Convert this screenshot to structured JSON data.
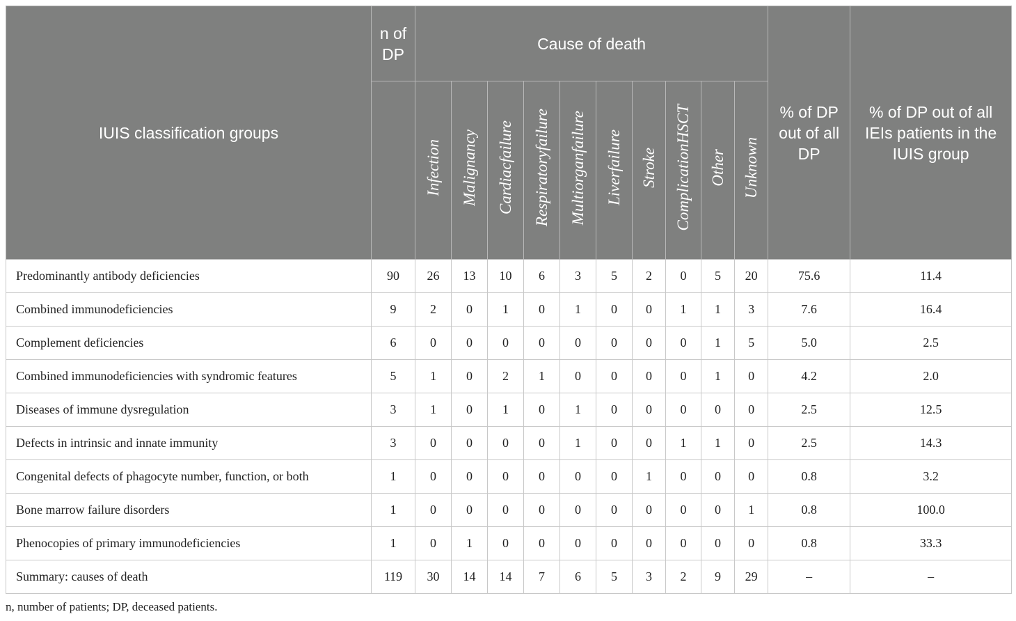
{
  "header": {
    "group_col": "IUIS classification groups",
    "n_col": "n of DP",
    "cause_group": "Cause of death",
    "causes": [
      "Infection",
      "Malignancy",
      "Cardiacfailure",
      "Respiratoryfailure",
      "Multiorganfailure",
      "Liverfailure",
      "Stroke",
      "ComplicationHSCT",
      "Other",
      "Unknown"
    ],
    "pct_all_col": "% of DP out of all DP",
    "pct_group_col": "% of DP out of all IEIs patients in the IUIS group"
  },
  "rows": [
    {
      "group": "Predominantly antibody deficiencies",
      "n": "90",
      "causes": [
        "26",
        "13",
        "10",
        "6",
        "3",
        "5",
        "2",
        "0",
        "5",
        "20"
      ],
      "pct_all": "75.6",
      "pct_group": "11.4"
    },
    {
      "group": "Combined immunodeficiencies",
      "n": "9",
      "causes": [
        "2",
        "0",
        "1",
        "0",
        "1",
        "0",
        "0",
        "1",
        "1",
        "3"
      ],
      "pct_all": "7.6",
      "pct_group": "16.4"
    },
    {
      "group": "Complement deficiencies",
      "n": "6",
      "causes": [
        "0",
        "0",
        "0",
        "0",
        "0",
        "0",
        "0",
        "0",
        "1",
        "5"
      ],
      "pct_all": "5.0",
      "pct_group": "2.5"
    },
    {
      "group": "Combined immunodeficiencies with syndromic features",
      "n": "5",
      "causes": [
        "1",
        "0",
        "2",
        "1",
        "0",
        "0",
        "0",
        "0",
        "1",
        "0"
      ],
      "pct_all": "4.2",
      "pct_group": "2.0"
    },
    {
      "group": "Diseases of immune dysregulation",
      "n": "3",
      "causes": [
        "1",
        "0",
        "1",
        "0",
        "1",
        "0",
        "0",
        "0",
        "0",
        "0"
      ],
      "pct_all": "2.5",
      "pct_group": "12.5"
    },
    {
      "group": "Defects in intrinsic and innate immunity",
      "n": "3",
      "causes": [
        "0",
        "0",
        "0",
        "0",
        "1",
        "0",
        "0",
        "1",
        "1",
        "0"
      ],
      "pct_all": "2.5",
      "pct_group": "14.3"
    },
    {
      "group": "Congenital defects of phagocyte number, function, or both",
      "n": "1",
      "causes": [
        "0",
        "0",
        "0",
        "0",
        "0",
        "0",
        "1",
        "0",
        "0",
        "0"
      ],
      "pct_all": "0.8",
      "pct_group": "3.2"
    },
    {
      "group": "Bone marrow failure disorders",
      "n": "1",
      "causes": [
        "0",
        "0",
        "0",
        "0",
        "0",
        "0",
        "0",
        "0",
        "0",
        "1"
      ],
      "pct_all": "0.8",
      "pct_group": "100.0"
    },
    {
      "group": "Phenocopies of primary immunodeficiencies",
      "n": "1",
      "causes": [
        "0",
        "1",
        "0",
        "0",
        "0",
        "0",
        "0",
        "0",
        "0",
        "0"
      ],
      "pct_all": "0.8",
      "pct_group": "33.3"
    },
    {
      "group": "Summary: causes of death",
      "n": "119",
      "causes": [
        "30",
        "14",
        "14",
        "7",
        "6",
        "5",
        "3",
        "2",
        "9",
        "29"
      ],
      "pct_all": "–",
      "pct_group": "–"
    }
  ],
  "footnote": "n, number of patients; DP, deceased patients.",
  "colors": {
    "header_bg": "#7f807f",
    "header_text": "#ffffff",
    "border": "#c8c8c8",
    "text": "#222222"
  }
}
